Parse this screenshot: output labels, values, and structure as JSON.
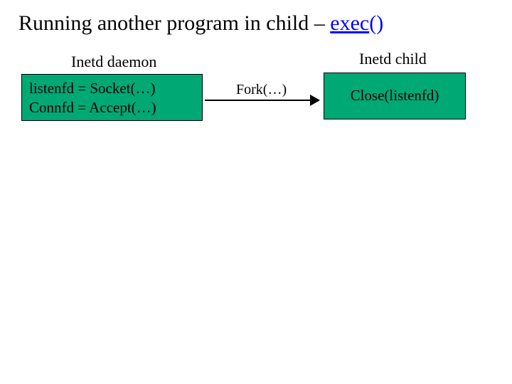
{
  "title": {
    "prefix": "Running another program in child – ",
    "exec_part": "exec",
    "parens": "()"
  },
  "labels": {
    "daemon": "Inetd daemon",
    "child": "Inetd child"
  },
  "boxes": {
    "left_line1": "listenfd = Socket(…)",
    "left_line2": "Connfd = Accept(…)",
    "right": "Close(listenfd)"
  },
  "arrow": {
    "label": "Fork(…)"
  }
}
